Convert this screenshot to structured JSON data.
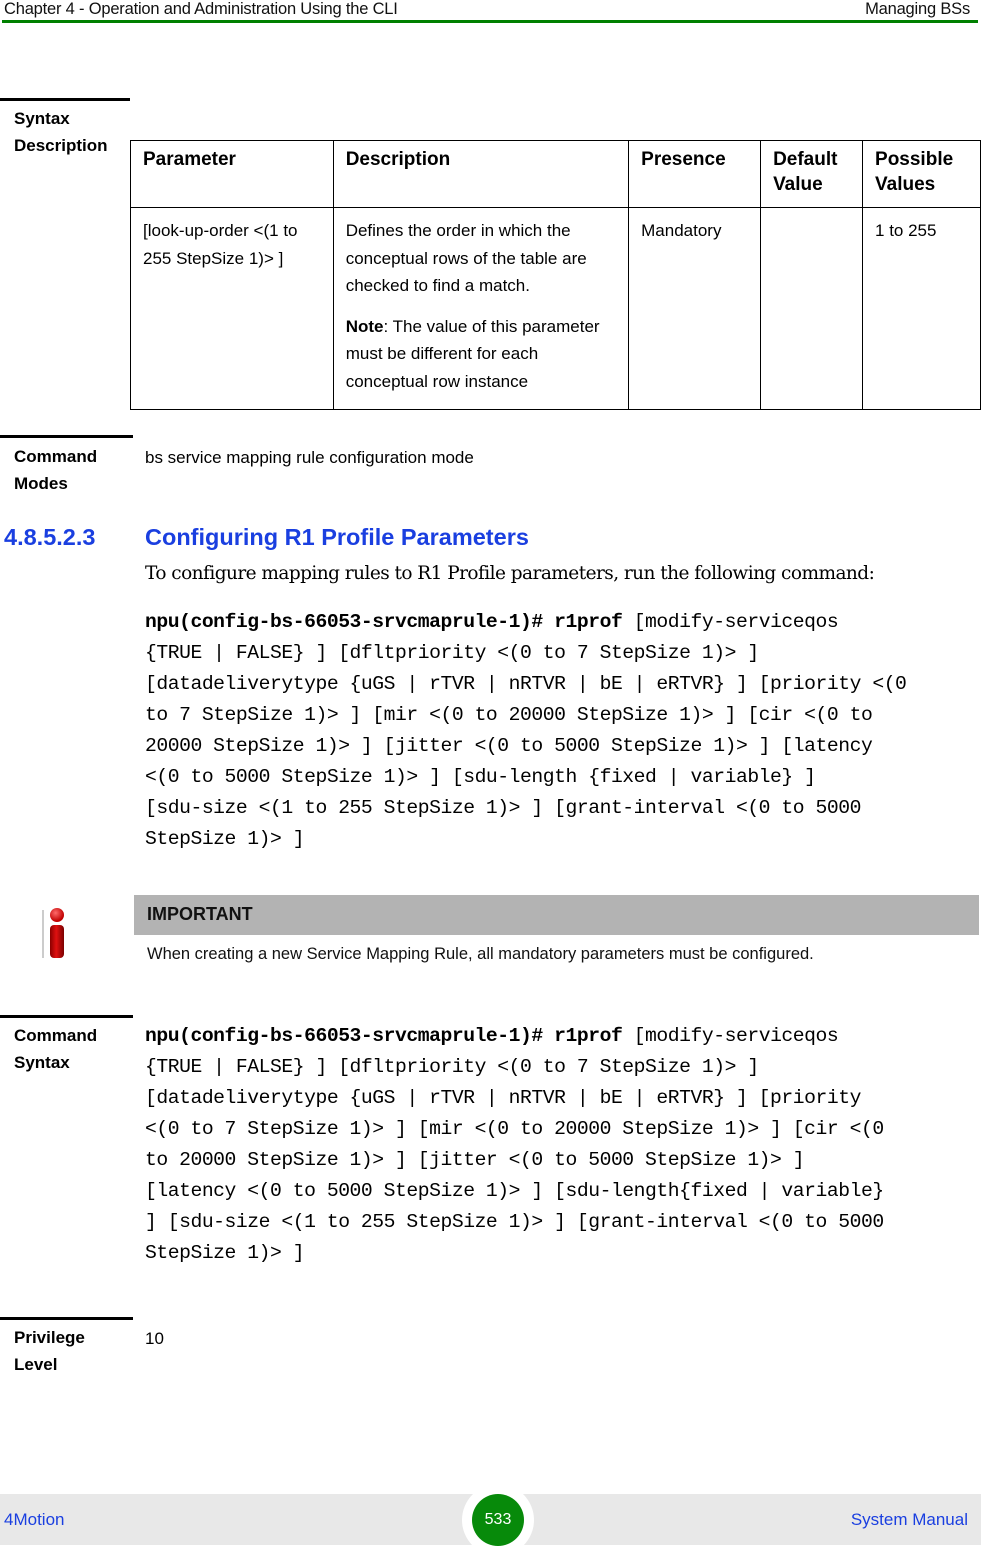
{
  "header": {
    "chapter": "Chapter 4 - Operation and Administration Using the CLI",
    "section": "Managing BSs",
    "rule_color": "#008000"
  },
  "syntax_description": {
    "label_line1": "Syntax",
    "label_line2": "Description",
    "table": {
      "headers": [
        "Parameter",
        "Description",
        "Presence",
        "Default Value",
        "Possible Values"
      ],
      "header_lines": {
        "default": [
          "Default",
          "Value"
        ],
        "possible": [
          "Possible",
          "Values"
        ]
      },
      "rows": [
        {
          "parameter": "[look-up-order <(1 to 255 StepSize 1)> ]",
          "description": "Defines the order in which the conceptual rows of  the table are checked to find a match.",
          "note_label": "Note",
          "note_text": ": The value of this parameter must be different for each conceptual row instance",
          "presence": "Mandatory",
          "default_value": "",
          "possible_values": "1 to 255"
        }
      ]
    }
  },
  "command_modes": {
    "label_line1": "Command",
    "label_line2": "Modes",
    "value": "bs service mapping rule configuration mode"
  },
  "section": {
    "number": "4.8.5.2.3",
    "title": "Configuring R1 Profile Parameters",
    "intro": "To configure mapping rules to R1 Profile parameters, run the following command:",
    "color": "#1a3fe0"
  },
  "command_example": {
    "prompt": "npu(config-bs-66053-srvcmaprule-1)#",
    "keyword": "r1prof",
    "lines": [
      " [modify-serviceqos",
      "{TRUE | FALSE} ] [dfltpriority <(0 to 7 StepSize 1)> ]",
      "[datadeliverytype {uGS | rTVR | nRTVR | bE | eRTVR} ] [priority <(0",
      "to 7 StepSize 1)> ] [mir <(0 to 20000 StepSize 1)> ] [cir <(0 to",
      "20000 StepSize 1)> ] [jitter <(0 to 5000 StepSize 1)> ] [latency",
      "<(0 to 5000 StepSize 1)> ] [sdu-length {fixed | variable} ]",
      "[sdu-size <(1 to 255 StepSize 1)> ] [grant-interval <(0 to 5000",
      "StepSize 1)> ]"
    ]
  },
  "important": {
    "icon": "info-icon",
    "title": "IMPORTANT",
    "text": "When creating a new Service Mapping Rule, all mandatory parameters must be configured."
  },
  "command_syntax": {
    "label_line1": "Command",
    "label_line2": "Syntax",
    "prompt": "npu(config-bs-66053-srvcmaprule-1)#",
    "keyword": "r1prof",
    "lines": [
      " [modify-serviceqos",
      "{TRUE | FALSE} ] [dfltpriority <(0 to 7 StepSize 1)> ]",
      "[datadeliverytype {uGS | rTVR | nRTVR | bE | eRTVR} ] [priority",
      "<(0 to 7 StepSize 1)> ] [mir <(0 to 20000 StepSize 1)> ] [cir <(0",
      "to 20000 StepSize 1)> ] [jitter <(0 to 5000 StepSize 1)> ]",
      "[latency <(0 to 5000 StepSize 1)> ] [sdu-length{fixed | variable}",
      "] [sdu-size <(1 to 255 StepSize 1)> ] [grant-interval <(0 to 5000",
      "StepSize 1)> ]"
    ]
  },
  "privilege_level": {
    "label_line1": "Privilege",
    "label_line2": "Level",
    "value": "10"
  },
  "footer": {
    "left": "4Motion",
    "page_number": "533",
    "right": "System Manual",
    "badge_color": "#078a0a"
  }
}
